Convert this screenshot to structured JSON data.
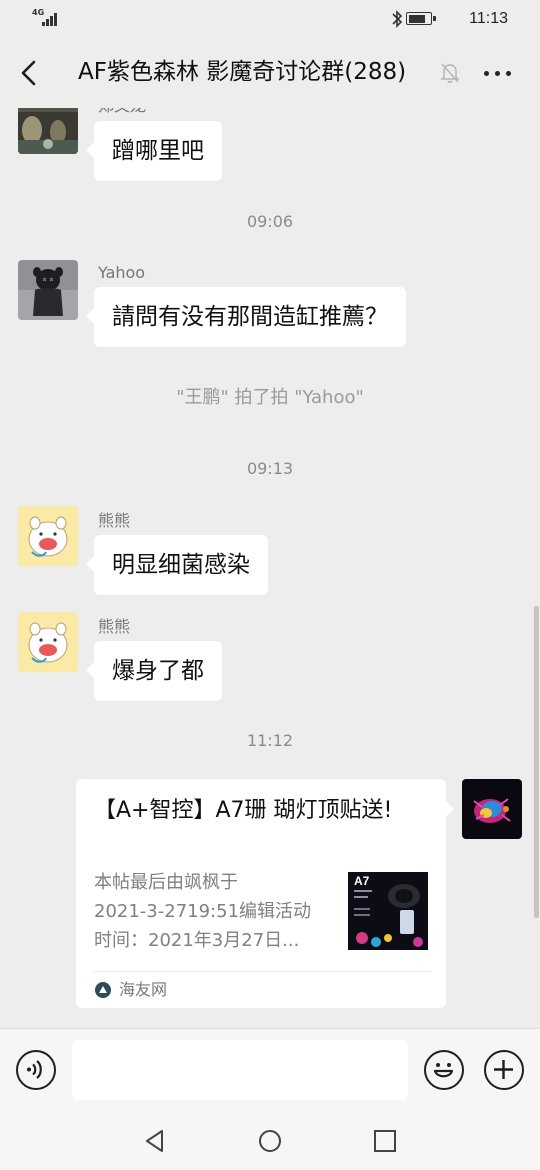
{
  "status_bar": {
    "network": "4G",
    "battery_level": 0.8,
    "time": "11:13"
  },
  "header": {
    "back_icon": "chevron-left-icon",
    "title": "AF紫色森林 影魔奇讨论群(288)",
    "mute_icon": "bell-muted-icon",
    "more_icon": "more-dots-icon"
  },
  "messages": [
    {
      "type": "incoming",
      "nickname": "郑文龙",
      "text": "蹭哪里吧"
    },
    {
      "type": "timestamp",
      "text": "09:06"
    },
    {
      "type": "incoming",
      "nickname": "Yahoo",
      "text": "請問有没有那間造缸推薦？"
    },
    {
      "type": "system",
      "text": "\"王鹏\" 拍了拍 \"Yahoo\""
    },
    {
      "type": "timestamp",
      "text": "09:13"
    },
    {
      "type": "incoming",
      "nickname": "熊熊",
      "text": "明显细菌感染"
    },
    {
      "type": "incoming",
      "nickname": "熊熊",
      "text": "爆身了都"
    },
    {
      "type": "timestamp",
      "text": "11:12"
    },
    {
      "type": "outgoing-card",
      "title": "【A+智控】A7珊 瑚灯顶贴送!",
      "desc_lines": [
        "本帖最后由飒枫于",
        "2021-3-2719:51编辑活动",
        "时间：2021年3月27日..."
      ],
      "thumb_label": "A7",
      "source": "海友网"
    }
  ],
  "input_bar": {
    "voice_icon": "voice-icon",
    "placeholder": "",
    "emoji_icon": "emoji-icon",
    "plus_icon": "plus-icon"
  },
  "nav_bar": {
    "back_icon": "triangle-back-icon",
    "home_icon": "circle-home-icon",
    "recents_icon": "square-recents-icon"
  },
  "colors": {
    "background": "#ededed",
    "bubble": "#ffffff",
    "text": "#111111",
    "meta_text": "#8a8a8a"
  }
}
